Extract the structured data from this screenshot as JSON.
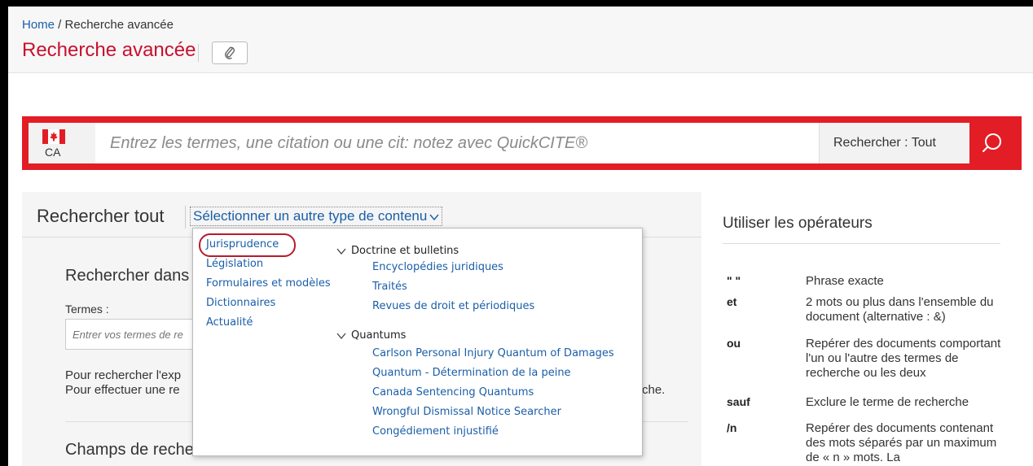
{
  "breadcrumb": {
    "home": "Home",
    "separator": " / ",
    "current": "Recherche avancée"
  },
  "page_title": "Recherche avancée",
  "search": {
    "country_code": "CA",
    "placeholder": "Entrez les termes, une citation ou une cit: notez avec QuickCITE®",
    "scope_label": "Rechercher : Tout"
  },
  "panel": {
    "title": "Rechercher tout",
    "type_select": "Sélectionner un autre type de contenu",
    "subsection_title": "Rechercher dans",
    "terms_label": "Termes :",
    "terms_placeholder": "Entrer vos termes de re",
    "help_line1": "Pour rechercher l'exp",
    "help_line2": "Pour effectuer une re",
    "help_tail": "che.",
    "fields_title": "Champs de reche"
  },
  "dropdown": {
    "left_items": [
      "Jurisprudence",
      "Législation",
      "Formulaires et modèles",
      "Dictionnaires",
      "Actualité"
    ],
    "groups": [
      {
        "label": "Doctrine et bulletins",
        "items": [
          "Encyclopédies juridiques",
          "Traités",
          "Revues de droit et périodiques"
        ]
      },
      {
        "label": "Quantums",
        "items": [
          "Carlson Personal Injury Quantum of Damages",
          "Quantum - Détermination de la peine",
          "Canada Sentencing Quantums",
          "Wrongful Dismissal Notice Searcher",
          "Congédiement injustifié"
        ]
      }
    ]
  },
  "operators": {
    "title": "Utiliser les opérateurs",
    "rows": [
      {
        "symbol": "\" \"",
        "description": "Phrase exacte"
      },
      {
        "symbol": "et",
        "description": "2 mots ou plus dans l'ensemble du document (alternative : &)"
      },
      {
        "symbol": "ou",
        "description": "Repérer des documents comportant l'un ou l'autre des termes de recherche ou les deux"
      },
      {
        "symbol": "sauf",
        "description": "Exclure le terme de recherche"
      },
      {
        "symbol": "/n",
        "description": "Repérer des documents contenant des mots séparés par un maximum de « n » mots. La"
      }
    ]
  },
  "colors": {
    "brand_red": "#e31d25",
    "link_blue": "#1a5ea8",
    "highlight_ring": "#b71c2b"
  }
}
